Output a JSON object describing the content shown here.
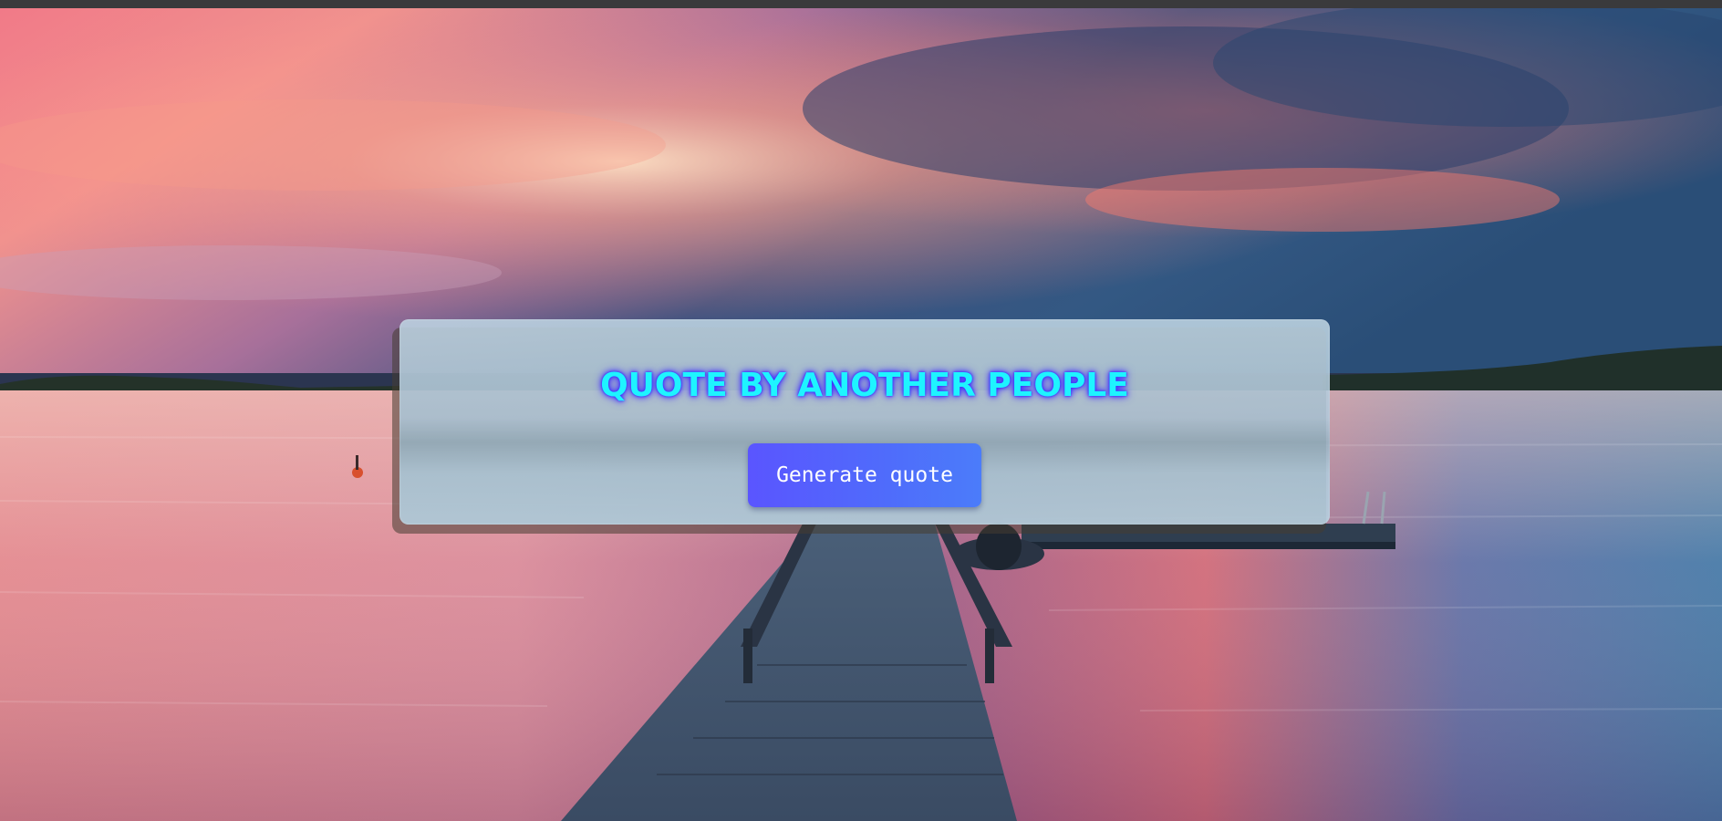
{
  "heading": "QUOTE BY ANOTHER PEOPLE",
  "generate_button_label": "Generate quote",
  "colors": {
    "heading": "#1ef4ff",
    "heading_glow": "#3c2cff",
    "button": "#5a55ff",
    "button_text": "#ffffff"
  }
}
